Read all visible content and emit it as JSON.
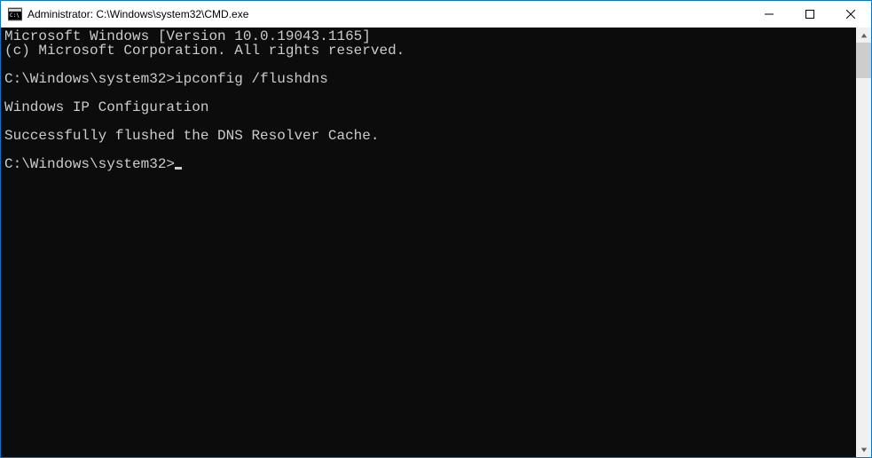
{
  "titlebar": {
    "title": "Administrator: C:\\Windows\\system32\\CMD.exe"
  },
  "terminal": {
    "lines": [
      "Microsoft Windows [Version 10.0.19043.1165]",
      "(c) Microsoft Corporation. All rights reserved.",
      "",
      "C:\\Windows\\system32>ipconfig /flushdns",
      "",
      "Windows IP Configuration",
      "",
      "Successfully flushed the DNS Resolver Cache.",
      "",
      "C:\\Windows\\system32>"
    ]
  }
}
